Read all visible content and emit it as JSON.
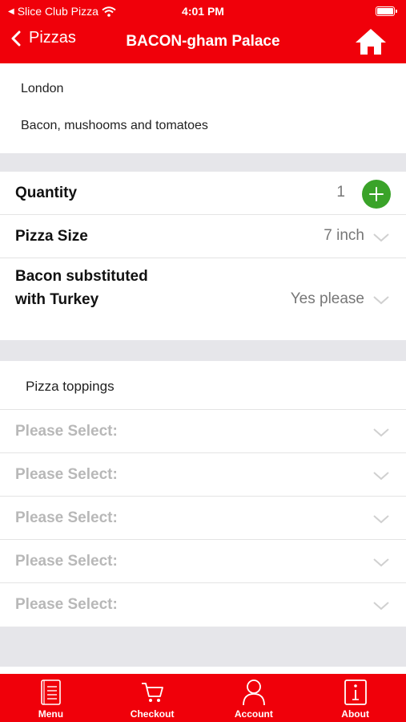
{
  "status_bar": {
    "carrier": "Slice Club Pizza",
    "time": "4:01 PM"
  },
  "nav": {
    "back_label": "Pizzas",
    "title": "BACON-gham Palace",
    "home_icon": "home-icon"
  },
  "info": {
    "location": "London",
    "description": "Bacon, mushooms and tomatoes"
  },
  "options": {
    "quantity_label": "Quantity",
    "quantity_value": "1",
    "size_label": "Pizza Size",
    "size_value": "7 inch",
    "bacon_label": "Bacon substituted with Turkey",
    "bacon_value": "Yes please"
  },
  "toppings": {
    "label": "Pizza toppings",
    "selects": [
      "Please Select:",
      "Please Select:",
      "Please Select:",
      "Please Select:",
      "Please Select:"
    ]
  },
  "tabbar": {
    "items": [
      {
        "label": "Menu",
        "icon": "menu-book-icon"
      },
      {
        "label": "Checkout",
        "icon": "cart-icon"
      },
      {
        "label": "Account",
        "icon": "person-icon"
      },
      {
        "label": "About",
        "icon": "info-icon"
      }
    ]
  },
  "colors": {
    "brand_red": "#f0000a",
    "add_green": "#3aa329"
  }
}
